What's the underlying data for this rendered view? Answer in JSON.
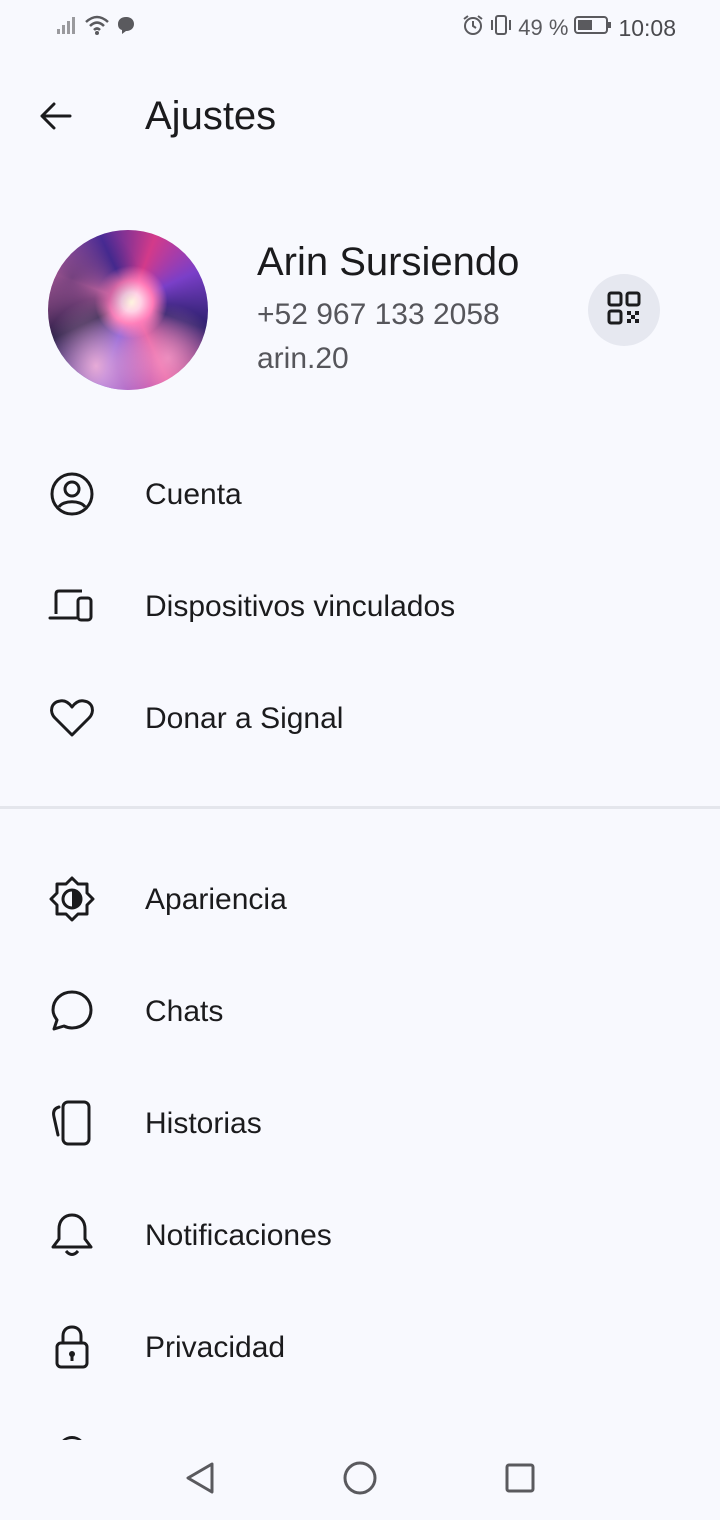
{
  "status_bar": {
    "battery": "49 %",
    "time": "10:08",
    "left_icons": [
      "signal-icon",
      "wifi-icon",
      "message-bubble-icon"
    ],
    "right_icons": [
      "alarm-icon",
      "vibrate-icon",
      "battery-icon"
    ]
  },
  "header": {
    "title": "Ajustes",
    "back_icon": "back-arrow-icon"
  },
  "profile": {
    "name": "Arin Sursiendo",
    "phone": "+52 967 133 2058",
    "username": "arin.20",
    "qr_icon": "qr-code-icon"
  },
  "menu_group1": [
    {
      "label": "Cuenta",
      "icon": "account-icon"
    },
    {
      "label": "Dispositivos vinculados",
      "icon": "linked-devices-icon"
    },
    {
      "label": "Donar a Signal",
      "icon": "heart-icon"
    }
  ],
  "menu_group2": [
    {
      "label": "Apariencia",
      "icon": "appearance-icon"
    },
    {
      "label": "Chats",
      "icon": "chat-bubble-icon"
    },
    {
      "label": "Historias",
      "icon": "stories-icon"
    },
    {
      "label": "Notificaciones",
      "icon": "bell-icon"
    },
    {
      "label": "Privacidad",
      "icon": "lock-icon"
    }
  ],
  "nav_bar": {
    "icons": [
      "nav-back-icon",
      "nav-home-icon",
      "nav-recents-icon"
    ]
  },
  "colors": {
    "background": "#f8f9fe",
    "text_primary": "#1b1b1d",
    "text_secondary": "#56565b",
    "qr_button_bg": "#e6e8f0",
    "divider": "#e4e6ec"
  }
}
